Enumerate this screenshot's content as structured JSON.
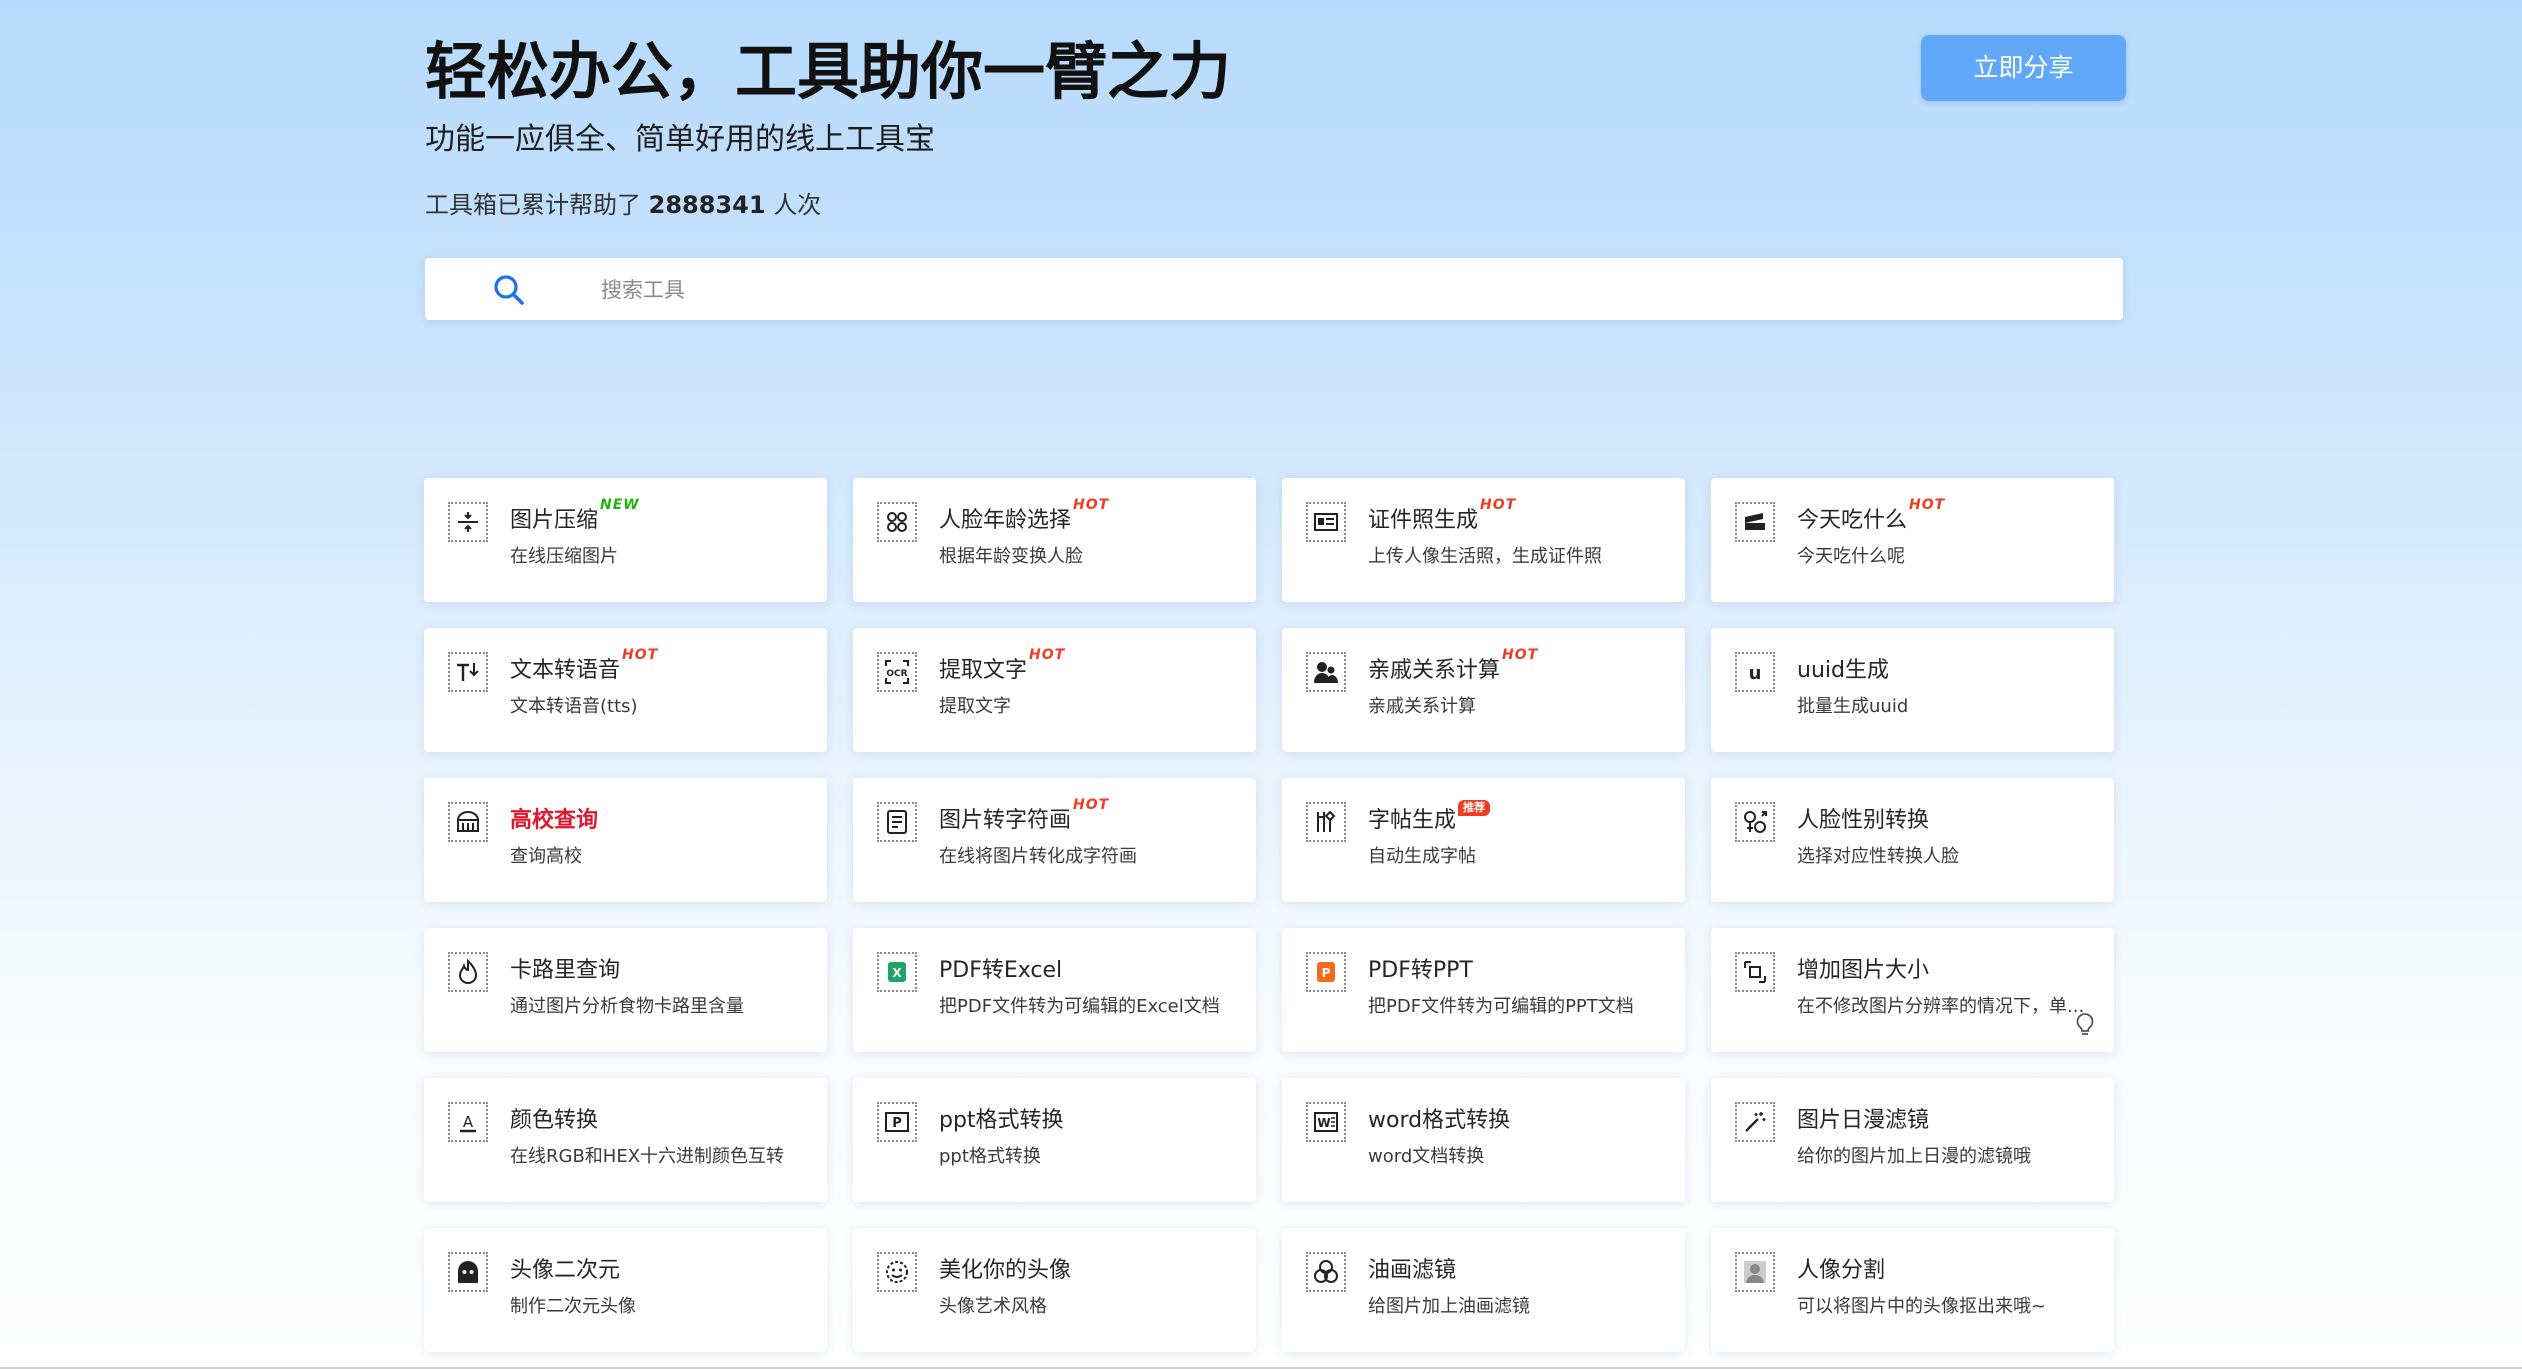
{
  "header": {
    "title": "轻松办公，工具助你一臂之力",
    "subtitle": "功能一应俱全、简单好用的线上工具宝",
    "counter_prefix": "工具箱已累计帮助了",
    "counter_value": "2888341",
    "counter_suffix": "人次",
    "share_label": "立即分享"
  },
  "search": {
    "placeholder": "搜索工具",
    "value": ""
  },
  "colors": {
    "accent": "#61a9f8",
    "hot_badge": "#ef3c23",
    "new_badge": "#22b510",
    "highlight_text": "#e0182d"
  },
  "tools": [
    {
      "name": "图片压缩",
      "desc": "在线压缩图片",
      "badge": "NEW",
      "icon": "compress-icon"
    },
    {
      "name": "人脸年龄选择",
      "desc": "根据年龄变换人脸",
      "badge": "HOT",
      "icon": "face-age-icon"
    },
    {
      "name": "证件照生成",
      "desc": "上传人像生活照，生成证件照",
      "badge": "HOT",
      "icon": "id-card-icon"
    },
    {
      "name": "今天吃什么",
      "desc": "今天吃什么呢",
      "badge": "HOT",
      "icon": "food-icon"
    },
    {
      "name": "文本转语音",
      "desc": "文本转语音(tts)",
      "badge": "HOT",
      "icon": "text-to-speech-icon"
    },
    {
      "name": "提取文字",
      "desc": "提取文字",
      "badge": "HOT",
      "icon": "ocr-icon"
    },
    {
      "name": "亲戚关系计算",
      "desc": "亲戚关系计算",
      "badge": "HOT",
      "icon": "relatives-icon"
    },
    {
      "name": "uuid生成",
      "desc": "批量生成uuid",
      "badge": "",
      "icon": "uuid-icon"
    },
    {
      "name": "高校查询",
      "desc": "查询高校",
      "badge": "",
      "icon": "university-icon"
    },
    {
      "name": "图片转字符画",
      "desc": "在线将图片转化成字符画",
      "badge": "HOT",
      "icon": "ascii-art-icon"
    },
    {
      "name": "字帖生成",
      "desc": "自动生成字帖",
      "badge": "推荐",
      "icon": "copybook-icon"
    },
    {
      "name": "人脸性别转换",
      "desc": "选择对应性转换人脸",
      "badge": "",
      "icon": "gender-swap-icon"
    },
    {
      "name": "卡路里查询",
      "desc": "通过图片分析食物卡路里含量",
      "badge": "",
      "icon": "calorie-icon"
    },
    {
      "name": "PDF转Excel",
      "desc": "把PDF文件转为可编辑的Excel文档",
      "badge": "",
      "icon": "pdf-excel-icon"
    },
    {
      "name": "PDF转PPT",
      "desc": "把PDF文件转为可编辑的PPT文档",
      "badge": "",
      "icon": "pdf-ppt-icon"
    },
    {
      "name": "增加图片大小",
      "desc": "在不修改图片分辨率的情况下，单...",
      "badge": "",
      "icon": "image-resize-icon"
    },
    {
      "name": "颜色转换",
      "desc": "在线RGB和HEX十六进制颜色互转",
      "badge": "",
      "icon": "color-convert-icon"
    },
    {
      "name": "ppt格式转换",
      "desc": "ppt格式转换",
      "badge": "",
      "icon": "ppt-icon"
    },
    {
      "name": "word格式转换",
      "desc": "word文档转换",
      "badge": "",
      "icon": "word-icon"
    },
    {
      "name": "图片日漫滤镜",
      "desc": "给你的图片加上日漫的滤镜哦",
      "badge": "",
      "icon": "anime-filter-icon"
    },
    {
      "name": "头像二次元",
      "desc": "制作二次元头像",
      "badge": "",
      "icon": "anime-avatar-icon"
    },
    {
      "name": "美化你的头像",
      "desc": "头像艺术风格",
      "badge": "",
      "icon": "beautify-avatar-icon"
    },
    {
      "name": "油画滤镜",
      "desc": "给图片加上油画滤镜",
      "badge": "",
      "icon": "oil-painting-icon"
    },
    {
      "name": "人像分割",
      "desc": "可以将图片中的头像抠出来哦~",
      "badge": "",
      "icon": "portrait-segment-icon"
    }
  ]
}
